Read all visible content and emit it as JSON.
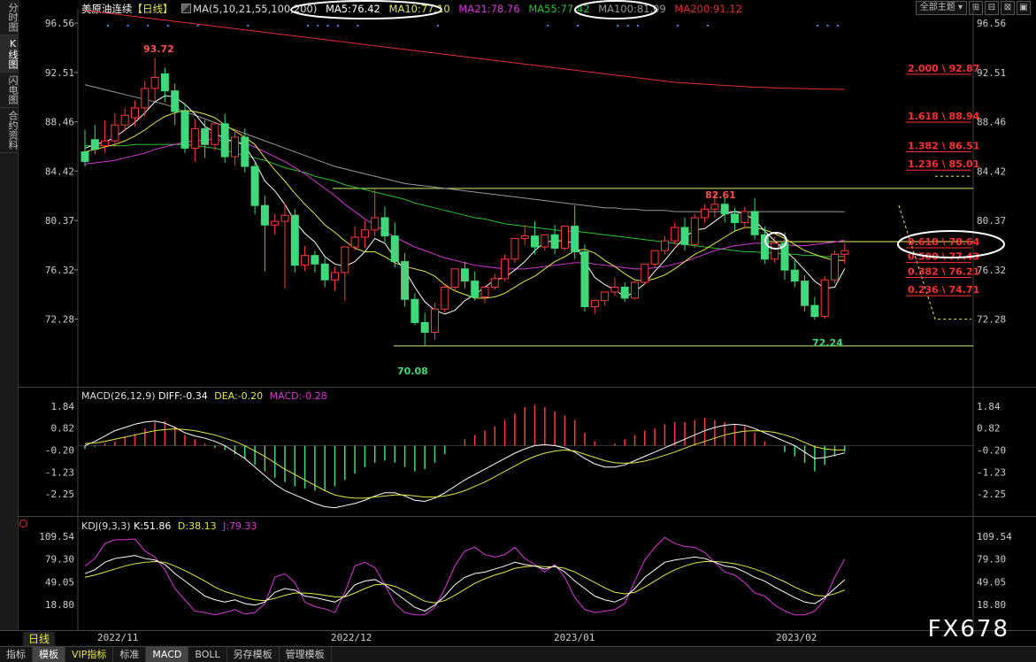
{
  "left_tabs": [
    "分时图",
    "K线图",
    "闪电图",
    "合约资料"
  ],
  "header": {
    "title": "美原油连续",
    "period_tag": "【日线】",
    "ma_label": "MA(5,10,21,55,100,200)",
    "ma5": "MA5:76.42",
    "ma10": "MA10:77.10",
    "ma21": "MA21:78.76",
    "ma55": "MA55:77.42",
    "ma100": "MA100:81.09",
    "ma200": "MA200:91.12"
  },
  "toolbar": {
    "theme_select": "全部主题",
    "chevron": "▾",
    "btn1": "⊞",
    "btn2": "⊟",
    "btn3": "⊠",
    "btn4": "▣"
  },
  "colors": {
    "up": "#ff3b3b",
    "down": "#3fd87a",
    "ma5": "#ffffff",
    "ma10": "#e6e64c",
    "ma21": "#d63ad6",
    "ma55": "#30c030",
    "ma100": "#999999",
    "ma200": "#e03030",
    "diff": "#ffffff",
    "dea": "#e6e64c",
    "k": "#ffffff",
    "d": "#e6e64c",
    "j": "#d63ad6"
  },
  "price_axis": [
    "96.56",
    "92.51",
    "88.46",
    "84.42",
    "80.37",
    "76.32",
    "72.28"
  ],
  "price_annotations": {
    "high": "93.72",
    "low": "70.08",
    "swing_high": "82.61",
    "recent_low": "72.24"
  },
  "fib_levels": [
    {
      "label": "2.000 \\ 92.87",
      "price": 92.87
    },
    {
      "label": "1.618 \\ 88.94",
      "price": 88.94
    },
    {
      "label": "1.382 \\ 86.51",
      "price": 86.51
    },
    {
      "label": "1.236 \\ 85.01",
      "price": 85.01
    },
    {
      "label": "0.618 \\ 78.64",
      "price": 78.64
    },
    {
      "label": "0.500 \\ 77.43",
      "price": 77.43
    },
    {
      "label": "0.382 \\ 76.21",
      "price": 76.21
    },
    {
      "label": "0.236 \\ 74.71",
      "price": 74.71
    }
  ],
  "macd": {
    "label": "MACD(26,12,9)",
    "diff": "DIFF:-0.34",
    "dea": "DEA:-0.20",
    "macd": "MACD:-0.28",
    "axis": [
      "1.84",
      "0.82",
      "-0.20",
      "-1.23",
      "-2.25"
    ]
  },
  "kdj": {
    "label": "KDJ(9,3,3)",
    "k": "K:51.86",
    "d": "D:38.13",
    "j": "J:79.33",
    "axis": [
      "109.54",
      "79.30",
      "49.05",
      "18.80"
    ]
  },
  "dates": [
    "2022/11",
    "2022/12",
    "2023/01",
    "2023/02"
  ],
  "period_button": "日线",
  "bottom_tabs": [
    "指标",
    "模板",
    "VIP指标",
    "标准",
    "MACD",
    "BOLL",
    "另存模板",
    "管理模板"
  ],
  "watermark": "FX678",
  "chart_data": {
    "type": "candlestick",
    "price_range": [
      68.5,
      97.5
    ],
    "candles": [
      [
        86.0,
        87.8,
        85.2,
        84.8
      ],
      [
        87.0,
        88.2,
        86.2,
        85.8
      ],
      [
        86.5,
        88.6,
        86.9,
        85.9
      ],
      [
        86.9,
        89.2,
        88.2,
        86.4
      ],
      [
        88.2,
        89.6,
        89.0,
        87.7
      ],
      [
        88.8,
        90.2,
        89.6,
        88.1
      ],
      [
        89.6,
        91.8,
        91.2,
        88.9
      ],
      [
        91.2,
        93.72,
        92.1,
        90.2
      ],
      [
        92.4,
        92.9,
        91.0,
        90.1
      ],
      [
        91.0,
        91.6,
        89.3,
        88.2
      ],
      [
        89.3,
        90.0,
        86.3,
        85.9
      ],
      [
        86.3,
        88.7,
        87.9,
        85.2
      ],
      [
        87.9,
        88.6,
        86.6,
        85.5
      ],
      [
        86.6,
        88.0,
        88.3,
        86.1
      ],
      [
        88.3,
        89.1,
        85.6,
        85.1
      ],
      [
        85.6,
        87.9,
        87.2,
        84.9
      ],
      [
        87.2,
        87.9,
        84.8,
        84.3
      ],
      [
        84.8,
        85.1,
        81.6,
        80.9
      ],
      [
        81.6,
        82.4,
        80.0,
        76.2
      ],
      [
        80.0,
        80.9,
        80.3,
        79.2
      ],
      [
        80.3,
        81.8,
        80.8,
        74.8
      ],
      [
        80.8,
        81.3,
        76.7,
        76.1
      ],
      [
        76.7,
        78.3,
        77.5,
        76.2
      ],
      [
        77.5,
        77.9,
        76.8,
        76.1
      ],
      [
        76.8,
        77.3,
        75.5,
        74.9
      ],
      [
        75.5,
        76.6,
        76.1,
        74.6
      ],
      [
        76.1,
        78.1,
        78.2,
        73.8
      ],
      [
        78.2,
        79.9,
        79.0,
        77.9
      ],
      [
        79.0,
        80.4,
        79.6,
        78.1
      ],
      [
        79.6,
        82.9,
        80.6,
        79.1
      ],
      [
        80.6,
        81.5,
        79.1,
        78.6
      ],
      [
        79.1,
        80.2,
        77.0,
        76.5
      ],
      [
        77.0,
        77.7,
        73.9,
        73.3
      ],
      [
        73.9,
        74.4,
        72.0,
        71.8
      ],
      [
        72.0,
        72.8,
        71.2,
        70.08
      ],
      [
        71.2,
        73.6,
        73.1,
        70.6
      ],
      [
        73.1,
        75.1,
        74.9,
        72.8
      ],
      [
        74.9,
        76.1,
        76.4,
        74.6
      ],
      [
        76.4,
        77.0,
        75.4,
        74.8
      ],
      [
        75.4,
        76.2,
        74.1,
        73.8
      ],
      [
        74.1,
        75.0,
        74.9,
        73.6
      ],
      [
        74.9,
        76.0,
        75.6,
        74.7
      ],
      [
        75.6,
        77.6,
        77.2,
        75.4
      ],
      [
        77.2,
        78.1,
        78.9,
        76.9
      ],
      [
        78.9,
        80.0,
        79.1,
        78.3
      ],
      [
        79.1,
        80.3,
        78.2,
        77.6
      ],
      [
        78.2,
        79.2,
        79.2,
        77.9
      ],
      [
        79.2,
        80.0,
        78.1,
        77.6
      ],
      [
        78.1,
        79.5,
        79.9,
        77.9
      ],
      [
        79.9,
        81.6,
        77.8,
        77.2
      ],
      [
        77.8,
        78.4,
        73.3,
        72.9
      ],
      [
        73.3,
        73.9,
        73.8,
        72.7
      ],
      [
        73.8,
        74.4,
        74.5,
        73.4
      ],
      [
        74.5,
        75.7,
        74.9,
        74.2
      ],
      [
        74.9,
        75.3,
        74.0,
        73.7
      ],
      [
        74.0,
        75.4,
        75.3,
        73.9
      ],
      [
        75.3,
        76.6,
        76.8,
        75.1
      ],
      [
        76.8,
        77.9,
        77.9,
        76.5
      ],
      [
        77.9,
        79.1,
        78.7,
        77.6
      ],
      [
        78.7,
        80.2,
        79.8,
        78.4
      ],
      [
        79.8,
        80.6,
        78.4,
        77.9
      ],
      [
        78.4,
        80.9,
        80.6,
        78.1
      ],
      [
        80.6,
        81.7,
        81.3,
        80.2
      ],
      [
        81.3,
        82.61,
        81.7,
        80.6
      ],
      [
        81.7,
        82.3,
        80.9,
        80.2
      ],
      [
        80.9,
        81.4,
        80.2,
        79.5
      ],
      [
        80.2,
        81.5,
        81.1,
        79.7
      ],
      [
        81.1,
        82.2,
        79.2,
        78.8
      ],
      [
        79.2,
        79.9,
        77.2,
        76.8
      ],
      [
        77.2,
        79.0,
        78.5,
        76.9
      ],
      [
        78.5,
        79.4,
        76.3,
        75.5
      ],
      [
        76.3,
        77.1,
        75.4,
        74.9
      ],
      [
        75.4,
        75.9,
        73.4,
        72.9
      ],
      [
        73.4,
        74.1,
        72.5,
        72.24
      ],
      [
        72.5,
        75.8,
        75.5,
        72.3
      ],
      [
        75.5,
        77.9,
        77.6,
        75.2
      ],
      [
        77.6,
        78.5,
        77.9,
        76.8
      ]
    ],
    "macd_range": [
      -3.1,
      2.2
    ],
    "macd_hist": [
      -0.15,
      -0.05,
      0.1,
      0.2,
      0.4,
      0.55,
      0.8,
      1.1,
      1.15,
      0.9,
      0.5,
      0.3,
      0.1,
      -0.1,
      -0.2,
      -0.4,
      -0.6,
      -0.9,
      -1.2,
      -1.5,
      -1.7,
      -1.9,
      -2.0,
      -2.1,
      -2.1,
      -1.9,
      -1.6,
      -1.3,
      -1.0,
      -0.8,
      -0.7,
      -0.8,
      -1.0,
      -1.2,
      -1.1,
      -0.8,
      -0.4,
      0.0,
      0.3,
      0.5,
      0.7,
      0.9,
      1.2,
      1.5,
      1.8,
      1.9,
      1.8,
      1.6,
      1.4,
      1.2,
      0.6,
      0.2,
      0.0,
      0.1,
      0.3,
      0.5,
      0.7,
      0.8,
      1.0,
      1.1,
      1.1,
      1.2,
      1.3,
      1.2,
      1.1,
      1.0,
      0.9,
      0.6,
      0.2,
      0.0,
      -0.3,
      -0.5,
      -0.8,
      -1.2,
      -0.9,
      -0.5,
      -0.28
    ],
    "macd_diff": [
      0.0,
      0.2,
      0.45,
      0.7,
      0.85,
      1.0,
      1.1,
      1.15,
      1.05,
      0.85,
      0.6,
      0.45,
      0.35,
      0.2,
      0.0,
      -0.3,
      -0.6,
      -1.0,
      -1.4,
      -1.8,
      -2.1,
      -2.3,
      -2.5,
      -2.7,
      -2.85,
      -2.9,
      -2.8,
      -2.7,
      -2.55,
      -2.35,
      -2.2,
      -2.2,
      -2.35,
      -2.55,
      -2.6,
      -2.45,
      -2.2,
      -1.9,
      -1.6,
      -1.35,
      -1.1,
      -0.85,
      -0.6,
      -0.35,
      -0.15,
      0.0,
      0.05,
      0.0,
      -0.1,
      -0.3,
      -0.6,
      -0.85,
      -1.0,
      -1.0,
      -0.9,
      -0.7,
      -0.5,
      -0.3,
      -0.1,
      0.1,
      0.3,
      0.5,
      0.7,
      0.85,
      0.95,
      1.0,
      0.95,
      0.8,
      0.6,
      0.4,
      0.2,
      0.0,
      -0.3,
      -0.6,
      -0.55,
      -0.45,
      -0.34
    ],
    "macd_dea": [
      0.1,
      0.12,
      0.2,
      0.3,
      0.4,
      0.5,
      0.6,
      0.7,
      0.75,
      0.78,
      0.75,
      0.7,
      0.6,
      0.5,
      0.35,
      0.2,
      0.0,
      -0.25,
      -0.5,
      -0.8,
      -1.1,
      -1.35,
      -1.6,
      -1.85,
      -2.1,
      -2.3,
      -2.4,
      -2.45,
      -2.45,
      -2.4,
      -2.35,
      -2.3,
      -2.3,
      -2.35,
      -2.4,
      -2.4,
      -2.35,
      -2.25,
      -2.1,
      -1.9,
      -1.7,
      -1.45,
      -1.2,
      -0.95,
      -0.7,
      -0.5,
      -0.35,
      -0.25,
      -0.2,
      -0.25,
      -0.4,
      -0.55,
      -0.7,
      -0.8,
      -0.82,
      -0.8,
      -0.72,
      -0.6,
      -0.45,
      -0.3,
      -0.12,
      0.05,
      0.2,
      0.35,
      0.5,
      0.6,
      0.68,
      0.7,
      0.68,
      0.62,
      0.5,
      0.35,
      0.15,
      -0.05,
      -0.15,
      -0.2,
      -0.2
    ],
    "kdj_range": [
      5,
      115
    ],
    "kdj_k": [
      60,
      65,
      75,
      80,
      82,
      84,
      80,
      78,
      72,
      60,
      50,
      40,
      30,
      25,
      22,
      25,
      20,
      18,
      22,
      35,
      40,
      38,
      30,
      28,
      25,
      22,
      30,
      45,
      50,
      52,
      45,
      35,
      25,
      15,
      10,
      18,
      30,
      45,
      55,
      60,
      62,
      66,
      70,
      75,
      72,
      70,
      66,
      70,
      62,
      50,
      40,
      30,
      25,
      22,
      28,
      40,
      55,
      65,
      75,
      78,
      80,
      82,
      80,
      75,
      70,
      68,
      62,
      55,
      50,
      42,
      35,
      28,
      22,
      20,
      28,
      40,
      51.86
    ],
    "kdj_d": [
      55,
      58,
      62,
      66,
      70,
      73,
      75,
      76,
      75,
      70,
      64,
      57,
      50,
      42,
      36,
      32,
      28,
      25,
      24,
      27,
      31,
      34,
      34,
      33,
      31,
      29,
      29,
      34,
      40,
      45,
      46,
      43,
      37,
      30,
      23,
      21,
      24,
      31,
      39,
      47,
      53,
      58,
      62,
      67,
      69,
      70,
      69,
      69,
      67,
      62,
      55,
      48,
      41,
      35,
      33,
      35,
      42,
      50,
      58,
      65,
      70,
      74,
      76,
      76,
      75,
      73,
      70,
      66,
      61,
      55,
      49,
      42,
      36,
      31,
      30,
      33,
      38.13
    ],
    "kdj_j": [
      70,
      80,
      100,
      105,
      105,
      106,
      90,
      82,
      65,
      40,
      25,
      10,
      8,
      5,
      8,
      12,
      6,
      8,
      20,
      55,
      60,
      48,
      22,
      16,
      13,
      8,
      35,
      70,
      75,
      68,
      45,
      20,
      8,
      5,
      5,
      15,
      40,
      70,
      90,
      95,
      85,
      82,
      85,
      95,
      80,
      72,
      62,
      72,
      55,
      28,
      12,
      8,
      10,
      12,
      20,
      50,
      78,
      95,
      108,
      100,
      96,
      95,
      88,
      75,
      62,
      58,
      48,
      34,
      30,
      18,
      10,
      5,
      5,
      10,
      25,
      55,
      79.33
    ],
    "ma5": [
      86.3,
      86.6,
      86.8,
      87.2,
      87.8,
      88.4,
      89.2,
      90.1,
      90.6,
      90.5,
      89.9,
      89.1,
      88.1,
      87.6,
      87.0,
      86.9,
      86.5,
      85.2,
      83.6,
      82.8,
      81.7,
      80.3,
      79.3,
      78.6,
      77.4,
      76.8,
      76.6,
      77.0,
      77.8,
      78.9,
      78.5,
      77.3,
      76.3,
      74.9,
      73.7,
      73.0,
      72.7,
      73.0,
      73.8,
      74.3,
      74.9,
      75.5,
      75.7,
      76.3,
      77.0,
      77.9,
      78.6,
      78.7,
      78.7,
      78.5,
      77.0,
      75.7,
      75.1,
      74.7,
      74.1,
      74.5,
      75.2,
      76.2,
      77.1,
      78.1,
      79.0,
      79.6,
      79.7,
      80.3,
      80.9,
      81.1,
      80.9,
      80.4,
      79.5,
      78.7,
      77.9,
      77.2,
      76.3,
      75.4,
      74.8,
      74.9,
      76.42
    ],
    "ma10": [
      86.0,
      86.2,
      86.4,
      86.6,
      86.9,
      87.3,
      87.8,
      88.4,
      88.9,
      89.2,
      89.4,
      89.3,
      89.1,
      88.8,
      88.2,
      87.7,
      87.2,
      86.6,
      85.5,
      84.5,
      83.6,
      82.6,
      81.7,
      80.9,
      80.0,
      79.4,
      78.7,
      78.1,
      77.8,
      77.8,
      77.4,
      76.9,
      76.6,
      76.4,
      76.2,
      75.8,
      75.1,
      74.6,
      74.3,
      74.0,
      74.0,
      74.1,
      74.4,
      74.9,
      75.4,
      75.8,
      76.4,
      77.0,
      77.4,
      77.9,
      78.0,
      77.7,
      77.1,
      76.6,
      76.0,
      75.5,
      75.4,
      75.6,
      75.9,
      76.4,
      77.0,
      77.6,
      78.0,
      78.5,
      79.0,
      79.5,
      79.8,
      79.8,
      79.6,
      79.3,
      78.9,
      78.4,
      77.9,
      77.6,
      77.3,
      77.1,
      77.1
    ],
    "ma21": [
      85.0,
      85.1,
      85.2,
      85.3,
      85.5,
      85.7,
      85.9,
      86.2,
      86.4,
      86.6,
      86.8,
      86.9,
      87.0,
      87.0,
      86.9,
      86.8,
      86.7,
      86.4,
      86.0,
      85.6,
      85.2,
      84.7,
      84.2,
      83.6,
      83.0,
      82.4,
      81.7,
      81.1,
      80.5,
      80.0,
      79.5,
      79.0,
      78.6,
      78.2,
      77.9,
      77.6,
      77.3,
      77.1,
      76.9,
      76.7,
      76.6,
      76.5,
      76.4,
      76.4,
      76.4,
      76.5,
      76.6,
      76.7,
      76.8,
      76.9,
      76.9,
      76.8,
      76.7,
      76.6,
      76.5,
      76.4,
      76.4,
      76.5,
      76.6,
      76.8,
      77.0,
      77.3,
      77.6,
      77.9,
      78.1,
      78.3,
      78.4,
      78.5,
      78.5,
      78.4,
      78.4,
      78.3,
      78.3,
      78.4,
      78.5,
      78.6,
      78.76
    ],
    "ma55": [
      86.5,
      86.5,
      86.5,
      86.5,
      86.5,
      86.6,
      86.6,
      86.6,
      86.6,
      86.6,
      86.6,
      86.5,
      86.4,
      86.3,
      86.1,
      85.9,
      85.7,
      85.5,
      85.3,
      85.0,
      84.7,
      84.5,
      84.3,
      84.0,
      83.8,
      83.6,
      83.3,
      83.1,
      82.9,
      82.7,
      82.5,
      82.3,
      82.1,
      81.8,
      81.6,
      81.4,
      81.2,
      81.0,
      80.8,
      80.6,
      80.5,
      80.3,
      80.1,
      80.0,
      79.9,
      79.8,
      79.7,
      79.6,
      79.5,
      79.5,
      79.4,
      79.3,
      79.2,
      79.1,
      79.0,
      78.9,
      78.8,
      78.7,
      78.6,
      78.5,
      78.4,
      78.3,
      78.2,
      78.1,
      78.0,
      77.9,
      77.8,
      77.8,
      77.7,
      77.7,
      77.6,
      77.6,
      77.5,
      77.5,
      77.4,
      77.4,
      77.42
    ],
    "ma100": [
      91.5,
      91.3,
      91.1,
      90.9,
      90.7,
      90.5,
      90.3,
      90.1,
      89.9,
      89.6,
      89.3,
      89.0,
      88.7,
      88.4,
      88.1,
      87.8,
      87.5,
      87.2,
      86.9,
      86.6,
      86.3,
      86.0,
      85.7,
      85.4,
      85.1,
      84.8,
      84.6,
      84.4,
      84.2,
      84.0,
      83.8,
      83.6,
      83.4,
      83.3,
      83.2,
      83.1,
      83.0,
      82.9,
      82.8,
      82.7,
      82.6,
      82.5,
      82.4,
      82.3,
      82.2,
      82.1,
      82.0,
      81.9,
      81.8,
      81.7,
      81.6,
      81.5,
      81.4,
      81.4,
      81.3,
      81.3,
      81.2,
      81.2,
      81.2,
      81.1,
      81.1,
      81.1,
      81.1,
      81.1,
      81.1,
      81.1,
      81.1,
      81.1,
      81.1,
      81.1,
      81.1,
      81.1,
      81.1,
      81.1,
      81.1,
      81.1,
      81.09
    ],
    "ma200": [
      97.6,
      97.5,
      97.4,
      97.3,
      97.2,
      97.1,
      97.0,
      96.9,
      96.8,
      96.7,
      96.6,
      96.5,
      96.4,
      96.3,
      96.2,
      96.1,
      96.0,
      95.9,
      95.8,
      95.7,
      95.6,
      95.5,
      95.4,
      95.3,
      95.2,
      95.1,
      95.0,
      94.9,
      94.8,
      94.7,
      94.6,
      94.5,
      94.4,
      94.3,
      94.2,
      94.1,
      94.0,
      93.9,
      93.8,
      93.7,
      93.6,
      93.5,
      93.4,
      93.3,
      93.2,
      93.1,
      93.0,
      92.9,
      92.8,
      92.7,
      92.6,
      92.5,
      92.4,
      92.3,
      92.2,
      92.1,
      92.0,
      91.9,
      91.8,
      91.7,
      91.65,
      91.6,
      91.55,
      91.5,
      91.45,
      91.4,
      91.35,
      91.3,
      91.28,
      91.25,
      91.22,
      91.2,
      91.18,
      91.16,
      91.14,
      91.13,
      91.12
    ]
  }
}
